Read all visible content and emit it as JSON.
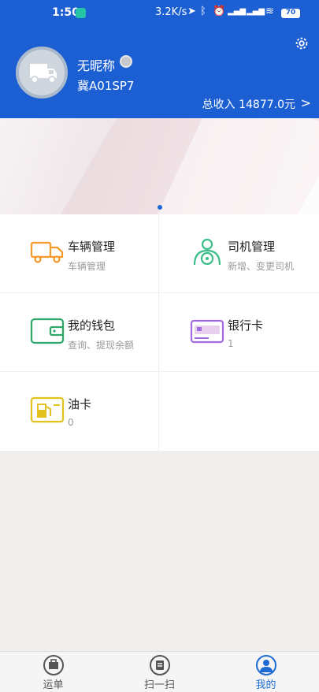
{
  "status_bar": {
    "time": "1:50",
    "network_speed": "3.2K/s",
    "battery": "70"
  },
  "header": {
    "nickname": "无昵称",
    "plate": "冀A01SP7",
    "income": "总收入 14877.0元",
    "income_chevron": ">"
  },
  "grid": [
    {
      "title": "车辆管理",
      "subtitle": "车辆管理",
      "icon": "truck-icon"
    },
    {
      "title": "司机管理",
      "subtitle": "新增、变更司机",
      "icon": "driver-icon"
    },
    {
      "title": "我的钱包",
      "subtitle": "查询、提现余额",
      "icon": "wallet-icon"
    },
    {
      "title": "银行卡",
      "subtitle": "1",
      "icon": "bank-card-icon"
    },
    {
      "title": "油卡",
      "subtitle": "0",
      "icon": "fuel-card-icon"
    }
  ],
  "tabs": [
    {
      "label": "运单",
      "icon": "waybill-icon",
      "active": false
    },
    {
      "label": "扫一扫",
      "icon": "scan-icon",
      "active": false
    },
    {
      "label": "我的",
      "icon": "profile-icon",
      "active": true
    }
  ],
  "colors": {
    "primary": "#1c5fd2",
    "truck": "#f39a2b",
    "driver": "#3bbf8a",
    "wallet": "#2ea86a",
    "bank": "#a36be0",
    "fuel": "#e3c21f"
  }
}
